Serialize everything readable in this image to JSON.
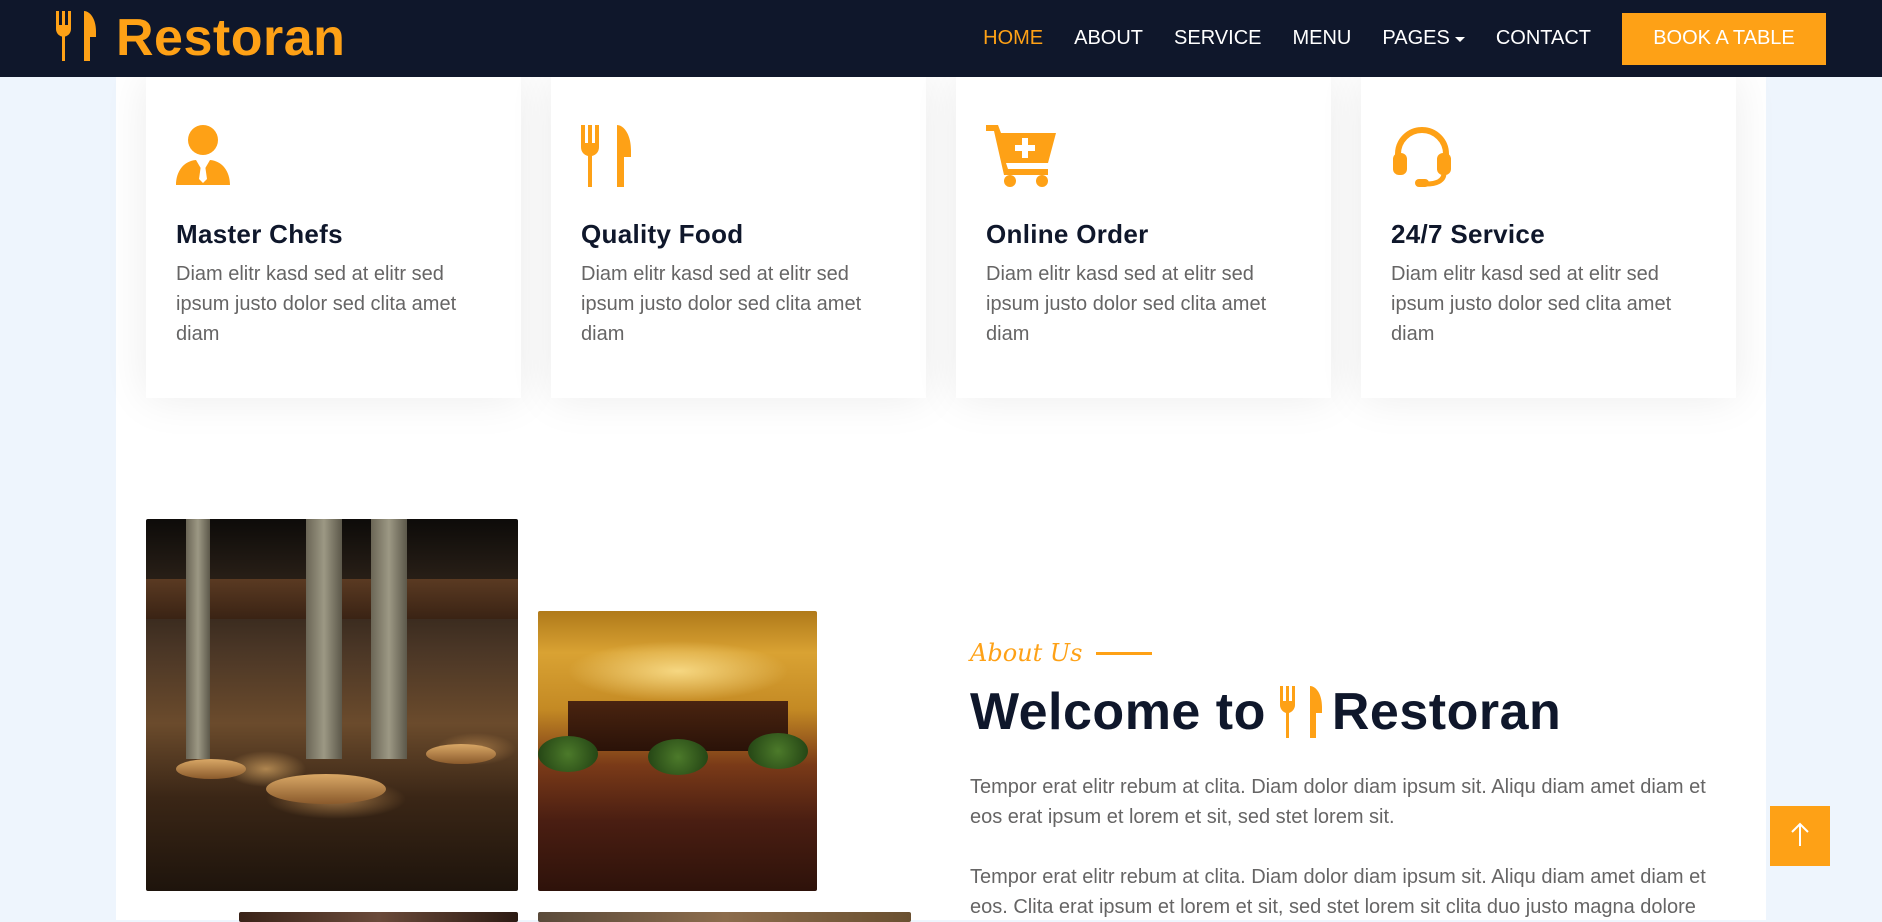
{
  "brand": {
    "name": "Restoran",
    "icon": "utensils-icon"
  },
  "nav": {
    "items": [
      {
        "label": "HOME",
        "active": true
      },
      {
        "label": "ABOUT",
        "active": false
      },
      {
        "label": "SERVICE",
        "active": false
      },
      {
        "label": "MENU",
        "active": false
      },
      {
        "label": "PAGES",
        "active": false,
        "dropdown": true
      },
      {
        "label": "CONTACT",
        "active": false
      }
    ],
    "cta": "BOOK A TABLE"
  },
  "services": [
    {
      "icon": "user-tie-icon",
      "title": "Master Chefs",
      "text": "Diam elitr kasd sed at elitr sed ipsum justo dolor sed clita amet diam"
    },
    {
      "icon": "utensils-icon",
      "title": "Quality Food",
      "text": "Diam elitr kasd sed at elitr sed ipsum justo dolor sed clita amet diam"
    },
    {
      "icon": "cart-plus-icon",
      "title": "Online Order",
      "text": "Diam elitr kasd sed at elitr sed ipsum justo dolor sed clita amet diam"
    },
    {
      "icon": "headset-icon",
      "title": "24/7 Service",
      "text": "Diam elitr kasd sed at elitr sed ipsum justo dolor sed clita amet diam"
    }
  ],
  "about": {
    "subtitle": "About Us",
    "title_prefix": "Welcome to",
    "title_brand": "Restoran",
    "paragraphs": [
      "Tempor erat elitr rebum at clita. Diam dolor diam ipsum sit. Aliqu diam amet diam et eos erat ipsum et lorem et sit, sed stet lorem sit.",
      "Tempor erat elitr rebum at clita. Diam dolor diam ipsum sit. Aliqu diam amet diam et eos. Clita erat ipsum et lorem et sit, sed stet lorem sit clita duo justo magna dolore"
    ]
  },
  "back_to_top": {
    "icon": "arrow-up-icon"
  },
  "colors": {
    "primary": "#fea116",
    "dark": "#0f172b",
    "text": "#666565",
    "page_bg": "#eef5fd"
  }
}
